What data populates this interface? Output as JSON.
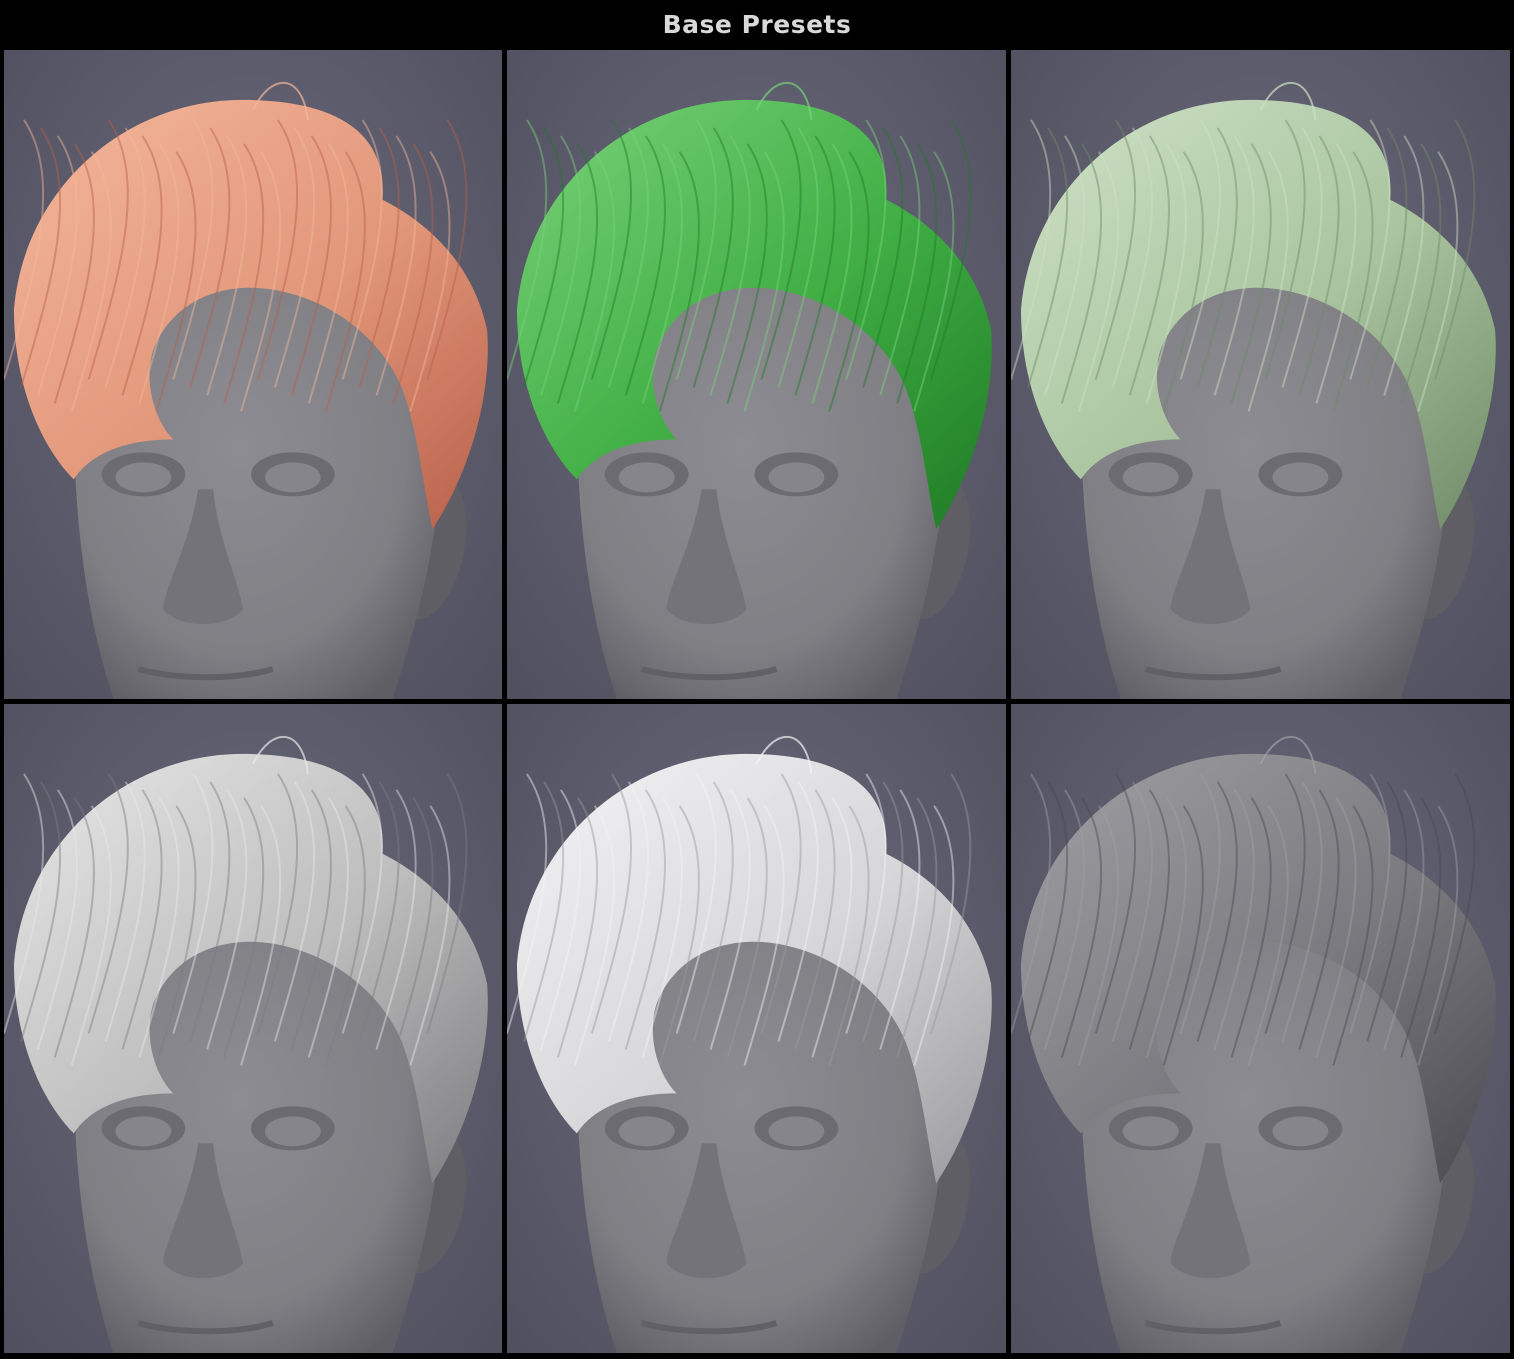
{
  "title": "Base Presets",
  "presets": [
    {
      "hair_color": "#e2977a",
      "hair_shadow": "#b8604a",
      "hair_highlight": "#f4b79c",
      "icon": "preset-preview-icon"
    },
    {
      "hair_color": "#3fae43",
      "hair_shadow": "#1f7a25",
      "hair_highlight": "#7ad27a",
      "icon": "preset-preview-icon"
    },
    {
      "hair_color": "#a9c49f",
      "hair_shadow": "#6f8a67",
      "hair_highlight": "#cfe2c6",
      "icon": "preset-preview-icon"
    },
    {
      "hair_color": "#bdbdbd",
      "hair_shadow": "#7c7c80",
      "hair_highlight": "#e8e8e8",
      "icon": "preset-preview-icon"
    },
    {
      "hair_color": "#d6d6d8",
      "hair_shadow": "#9a9a9e",
      "hair_highlight": "#f4f4f6",
      "icon": "preset-preview-icon"
    },
    {
      "hair_color": "#7b7b80",
      "hair_shadow": "#4a4a50",
      "hair_highlight": "#a0a0a4",
      "icon": "preset-preview-icon"
    }
  ],
  "colors": {
    "background": "#000000",
    "title_text": "#d9d9d9",
    "face": "#7f7f84",
    "face_shadow": "#5e5e64",
    "backdrop": "#5c5c6c"
  }
}
